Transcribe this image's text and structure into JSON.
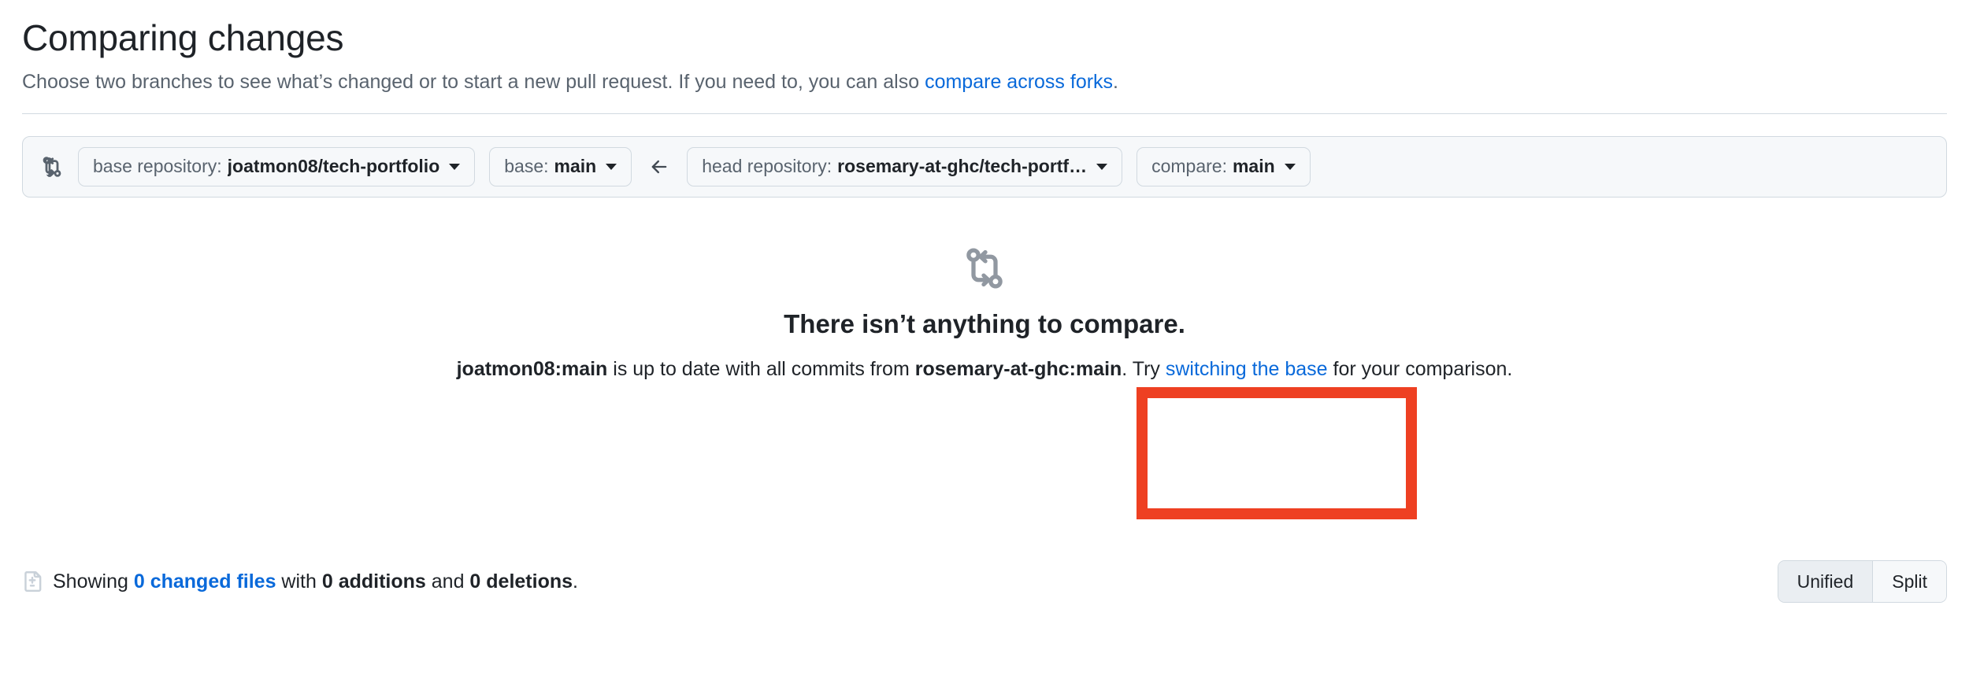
{
  "header": {
    "title": "Comparing changes",
    "subtitle_before": "Choose two branches to see what’s changed or to start a new pull request. If you need to, you can also ",
    "subtitle_link": "compare across forks",
    "subtitle_after": "."
  },
  "compare_bar": {
    "compare_icon": "git-compare-icon",
    "arrow_icon": "arrow-left-icon",
    "base_repository": {
      "label": "base repository:",
      "value": "joatmon08/tech-portfolio"
    },
    "base_branch": {
      "label": "base:",
      "value": "main"
    },
    "head_repository": {
      "label": "head repository:",
      "value": "rosemary-at-ghc/tech-portf…"
    },
    "compare_branch": {
      "label": "compare:",
      "value": "main"
    }
  },
  "blank_state": {
    "icon": "git-compare-icon",
    "title": "There isn’t anything to compare.",
    "desc_base_ref": "joatmon08:main",
    "desc_middle": " is up to date with all commits from ",
    "desc_head_ref": "rosemary-at-ghc:main",
    "desc_after_head": ". Try ",
    "desc_link": "switching the base",
    "desc_end": " for your comparison."
  },
  "footer": {
    "diff_icon": "file-diff-icon",
    "showing_label": "Showing ",
    "changed_files_link": "0 changed files",
    "with_label": " with ",
    "additions": "0 additions",
    "and_label": " and ",
    "deletions": "0 deletions",
    "period": ".",
    "diff_view": {
      "unified": "Unified",
      "split": "Split",
      "selected": "Unified"
    }
  },
  "annotation": {
    "name": "red-highlight-box",
    "color": "#ee4022"
  }
}
